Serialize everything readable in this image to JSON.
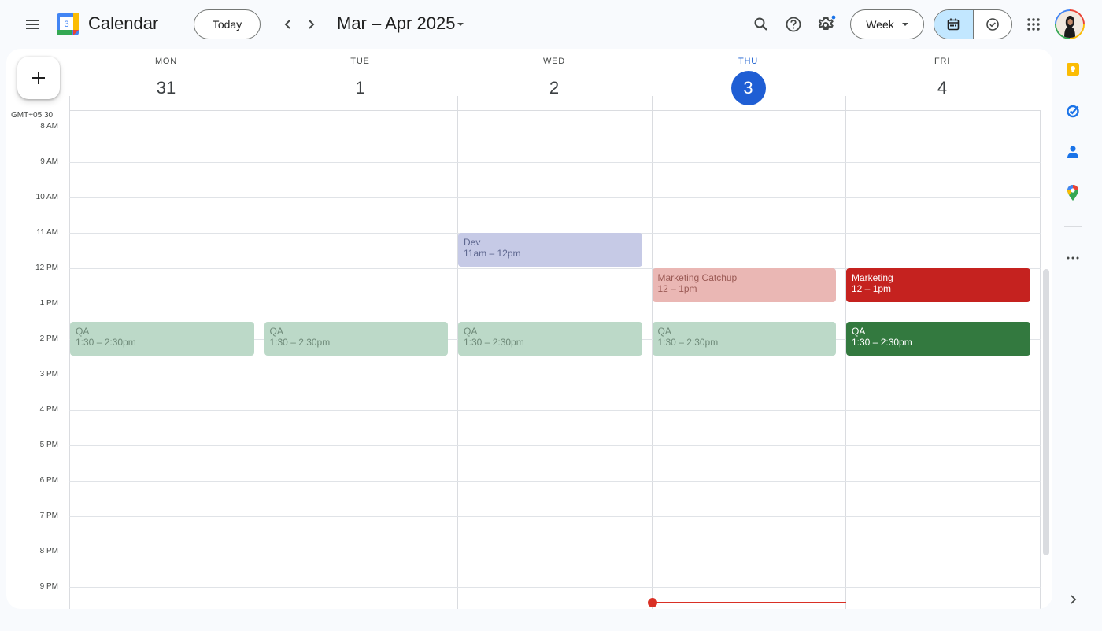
{
  "header": {
    "app_title": "Calendar",
    "logo_day": "3",
    "today_label": "Today",
    "date_range": "Mar – Apr 2025",
    "view_label": "Week"
  },
  "grid": {
    "timezone": "GMT+05:30",
    "hours": [
      "8 AM",
      "9 AM",
      "10 AM",
      "11 AM",
      "12 PM",
      "1 PM",
      "2 PM",
      "3 PM",
      "4 PM",
      "5 PM",
      "6 PM",
      "7 PM",
      "8 PM",
      "9 PM"
    ],
    "days": [
      {
        "dow": "MON",
        "date": "31",
        "today": false
      },
      {
        "dow": "TUE",
        "date": "1",
        "today": false
      },
      {
        "dow": "WED",
        "date": "2",
        "today": false
      },
      {
        "dow": "THU",
        "date": "3",
        "today": true
      },
      {
        "dow": "FRI",
        "date": "4",
        "today": false
      }
    ]
  },
  "events": [
    {
      "title": "Dev",
      "time": "11am – 12pm",
      "day": 2,
      "start_hour": 11.0,
      "end_hour": 12.0,
      "bg": "#c6cae6",
      "fg": "#5f6890"
    },
    {
      "title": "Marketing Catchup",
      "time": "12 – 1pm",
      "day": 3,
      "start_hour": 12.0,
      "end_hour": 13.0,
      "bg": "#eab7b4",
      "fg": "#9b5a55"
    },
    {
      "title": "Marketing",
      "time": "12 – 1pm",
      "day": 4,
      "start_hour": 12.0,
      "end_hour": 13.0,
      "bg": "#c5221f",
      "fg": "#ffffff"
    },
    {
      "title": "QA",
      "time": "1:30 – 2:30pm",
      "day": 0,
      "start_hour": 13.5,
      "end_hour": 14.5,
      "bg": "#bcd9c8",
      "fg": "#6f8a79"
    },
    {
      "title": "QA",
      "time": "1:30 – 2:30pm",
      "day": 1,
      "start_hour": 13.5,
      "end_hour": 14.5,
      "bg": "#bcd9c8",
      "fg": "#6f8a79"
    },
    {
      "title": "QA",
      "time": "1:30 – 2:30pm",
      "day": 2,
      "start_hour": 13.5,
      "end_hour": 14.5,
      "bg": "#bcd9c8",
      "fg": "#6f8a79"
    },
    {
      "title": "QA",
      "time": "1:30 – 2:30pm",
      "day": 3,
      "start_hour": 13.5,
      "end_hour": 14.5,
      "bg": "#bcd9c8",
      "fg": "#6f8a79"
    },
    {
      "title": "QA",
      "time": "1:30 – 2:30pm",
      "day": 4,
      "start_hour": 13.5,
      "end_hour": 14.5,
      "bg": "#33793f",
      "fg": "#ffffff"
    }
  ],
  "icons": {
    "menu": "menu-icon",
    "search": "search-icon",
    "help": "help-icon",
    "settings": "settings-icon",
    "apps": "apps-grid-icon",
    "keep": "keep-icon",
    "tasks": "tasks-icon",
    "contacts": "contacts-icon",
    "maps": "maps-icon"
  },
  "colors": {
    "accent": "#1f5ed4",
    "now_line": "#d93025"
  }
}
